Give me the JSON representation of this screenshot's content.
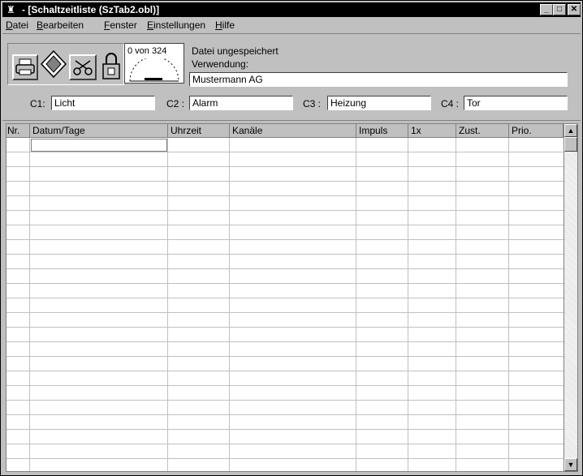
{
  "window": {
    "title": "- [Schaltzeitliste (SzTab2.obl)]",
    "btn_minimize": "_",
    "btn_restore": "□",
    "btn_close": "✕"
  },
  "menu": [
    {
      "label_first": "D",
      "label_rest": "atei"
    },
    {
      "label_first": "B",
      "label_rest": "earbeiten"
    },
    {
      "label_first": "F",
      "label_rest": "enster"
    },
    {
      "label_first": "E",
      "label_rest": "instellungen"
    },
    {
      "label_first": "H",
      "label_rest": "ilfe"
    }
  ],
  "toolbar": {
    "counter_text": "0 von 324",
    "file_status": "Datei ungespeichert",
    "usage_label": "Verwendung:",
    "usage_value": "Mustermann AG",
    "icons": [
      "printer-icon",
      "diskette-icon",
      "scissors-icon",
      "padlock-icon"
    ]
  },
  "channels": [
    {
      "label": "C1:",
      "value": "Licht"
    },
    {
      "label": "C2 :",
      "value": "Alarm"
    },
    {
      "label": "C3 :",
      "value": "Heizung"
    },
    {
      "label": "C4 :",
      "value": "Tor"
    }
  ],
  "table": {
    "columns": [
      "Nr.",
      "Datum/Tage",
      "Uhrzeit",
      "Kanäle",
      "Impuls",
      "1x",
      "Zust.",
      "Prio."
    ],
    "scroll_up": "▲",
    "scroll_down": "▼"
  }
}
